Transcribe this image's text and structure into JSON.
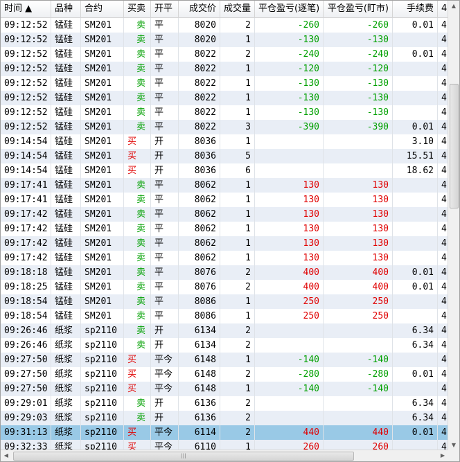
{
  "columns": [
    "时间 ▲",
    "品种",
    "合约",
    "买卖",
    "开平",
    "成交价",
    "成交量",
    "平仓盈亏(逐笔)",
    "平仓盈亏(盯市)",
    "手续费",
    "4"
  ],
  "rows": [
    [
      "09:12:52",
      "锰硅",
      "SM201",
      "卖",
      "平",
      "8020",
      "2",
      "-260",
      "-260",
      "0.01",
      "4"
    ],
    [
      "09:12:52",
      "锰硅",
      "SM201",
      "卖",
      "平",
      "8020",
      "1",
      "-130",
      "-130",
      "",
      "4"
    ],
    [
      "09:12:52",
      "锰硅",
      "SM201",
      "卖",
      "平",
      "8022",
      "2",
      "-240",
      "-240",
      "0.01",
      "4"
    ],
    [
      "09:12:52",
      "锰硅",
      "SM201",
      "卖",
      "平",
      "8022",
      "1",
      "-120",
      "-120",
      "",
      "4"
    ],
    [
      "09:12:52",
      "锰硅",
      "SM201",
      "卖",
      "平",
      "8022",
      "1",
      "-130",
      "-130",
      "",
      "4"
    ],
    [
      "09:12:52",
      "锰硅",
      "SM201",
      "卖",
      "平",
      "8022",
      "1",
      "-130",
      "-130",
      "",
      "4"
    ],
    [
      "09:12:52",
      "锰硅",
      "SM201",
      "卖",
      "平",
      "8022",
      "1",
      "-130",
      "-130",
      "",
      "4"
    ],
    [
      "09:12:52",
      "锰硅",
      "SM201",
      "卖",
      "平",
      "8022",
      "3",
      "-390",
      "-390",
      "0.01",
      "4"
    ],
    [
      "09:14:54",
      "锰硅",
      "SM201",
      "买",
      "开",
      "8036",
      "1",
      "",
      "",
      "3.10",
      "4"
    ],
    [
      "09:14:54",
      "锰硅",
      "SM201",
      "买",
      "开",
      "8036",
      "5",
      "",
      "",
      "15.51",
      "4"
    ],
    [
      "09:14:54",
      "锰硅",
      "SM201",
      "买",
      "开",
      "8036",
      "6",
      "",
      "",
      "18.62",
      "4"
    ],
    [
      "09:17:41",
      "锰硅",
      "SM201",
      "卖",
      "平",
      "8062",
      "1",
      "130",
      "130",
      "",
      "4"
    ],
    [
      "09:17:41",
      "锰硅",
      "SM201",
      "卖",
      "平",
      "8062",
      "1",
      "130",
      "130",
      "",
      "4"
    ],
    [
      "09:17:42",
      "锰硅",
      "SM201",
      "卖",
      "平",
      "8062",
      "1",
      "130",
      "130",
      "",
      "4"
    ],
    [
      "09:17:42",
      "锰硅",
      "SM201",
      "卖",
      "平",
      "8062",
      "1",
      "130",
      "130",
      "",
      "4"
    ],
    [
      "09:17:42",
      "锰硅",
      "SM201",
      "卖",
      "平",
      "8062",
      "1",
      "130",
      "130",
      "",
      "4"
    ],
    [
      "09:17:42",
      "锰硅",
      "SM201",
      "卖",
      "平",
      "8062",
      "1",
      "130",
      "130",
      "",
      "4"
    ],
    [
      "09:18:18",
      "锰硅",
      "SM201",
      "卖",
      "平",
      "8076",
      "2",
      "400",
      "400",
      "0.01",
      "4"
    ],
    [
      "09:18:25",
      "锰硅",
      "SM201",
      "卖",
      "平",
      "8076",
      "2",
      "400",
      "400",
      "0.01",
      "4"
    ],
    [
      "09:18:54",
      "锰硅",
      "SM201",
      "卖",
      "平",
      "8086",
      "1",
      "250",
      "250",
      "",
      "4"
    ],
    [
      "09:18:54",
      "锰硅",
      "SM201",
      "卖",
      "平",
      "8086",
      "1",
      "250",
      "250",
      "",
      "4"
    ],
    [
      "09:26:46",
      "纸浆",
      "sp2110",
      "卖",
      "开",
      "6134",
      "2",
      "",
      "",
      "6.34",
      "4"
    ],
    [
      "09:26:46",
      "纸浆",
      "sp2110",
      "卖",
      "开",
      "6134",
      "2",
      "",
      "",
      "6.34",
      "4"
    ],
    [
      "09:27:50",
      "纸浆",
      "sp2110",
      "买",
      "平今",
      "6148",
      "1",
      "-140",
      "-140",
      "",
      "4"
    ],
    [
      "09:27:50",
      "纸浆",
      "sp2110",
      "买",
      "平今",
      "6148",
      "2",
      "-280",
      "-280",
      "0.01",
      "4"
    ],
    [
      "09:27:50",
      "纸浆",
      "sp2110",
      "买",
      "平今",
      "6148",
      "1",
      "-140",
      "-140",
      "",
      "4"
    ],
    [
      "09:29:01",
      "纸浆",
      "sp2110",
      "卖",
      "开",
      "6136",
      "2",
      "",
      "",
      "6.34",
      "4"
    ],
    [
      "09:29:03",
      "纸浆",
      "sp2110",
      "卖",
      "开",
      "6136",
      "2",
      "",
      "",
      "6.34",
      "4"
    ],
    [
      "09:31:13",
      "纸浆",
      "sp2110",
      "买",
      "平今",
      "6114",
      "2",
      "440",
      "440",
      "0.01",
      "4"
    ],
    [
      "09:32:33",
      "纸浆",
      "sp2110",
      "买",
      "平今",
      "6110",
      "1",
      "260",
      "260",
      "",
      "4"
    ]
  ],
  "selected_row": 28,
  "colors": {
    "buy": "#e00000",
    "sell": "#00a000",
    "profit": "#e00000",
    "loss": "#00a000",
    "selected": "#99c9e6",
    "alt_row": "#e9eef6"
  },
  "icons": {
    "sort": "sort-ascending-icon",
    "up": "scroll-up-arrow-icon",
    "down": "scroll-down-arrow-icon",
    "left": "scroll-left-arrow-icon",
    "right": "scroll-right-arrow-icon"
  }
}
